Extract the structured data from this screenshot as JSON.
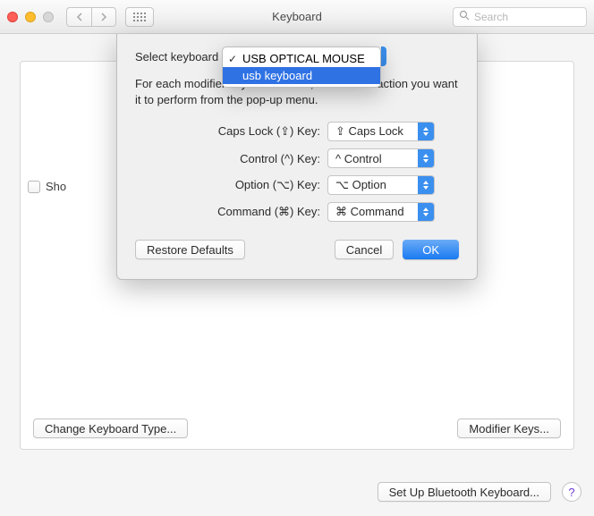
{
  "window": {
    "title": "Keyboard",
    "search_placeholder": "Search"
  },
  "main": {
    "checkbox_label": "Sho",
    "change_kbd_btn": "Change Keyboard Type...",
    "modifier_btn": "Modifier Keys..."
  },
  "footer": {
    "bluetooth_btn": "Set Up Bluetooth Keyboard...",
    "help": "?"
  },
  "sheet": {
    "select_label": "Select keyboard",
    "description": "For each modifier key listed below, choose the action you want it to perform from the pop-up menu.",
    "rows": [
      {
        "label": "Caps Lock (⇪) Key:",
        "value": "⇪ Caps Lock"
      },
      {
        "label": "Control (^) Key:",
        "value": "^ Control"
      },
      {
        "label": "Option (⌥) Key:",
        "value": "⌥ Option"
      },
      {
        "label": "Command (⌘) Key:",
        "value": "⌘ Command"
      }
    ],
    "restore_btn": "Restore Defaults",
    "cancel_btn": "Cancel",
    "ok_btn": "OK"
  },
  "dropdown": {
    "items": [
      {
        "label": "USB OPTICAL MOUSE",
        "selected": true,
        "hovered": false
      },
      {
        "label": "usb keyboard",
        "selected": false,
        "hovered": true
      }
    ]
  }
}
